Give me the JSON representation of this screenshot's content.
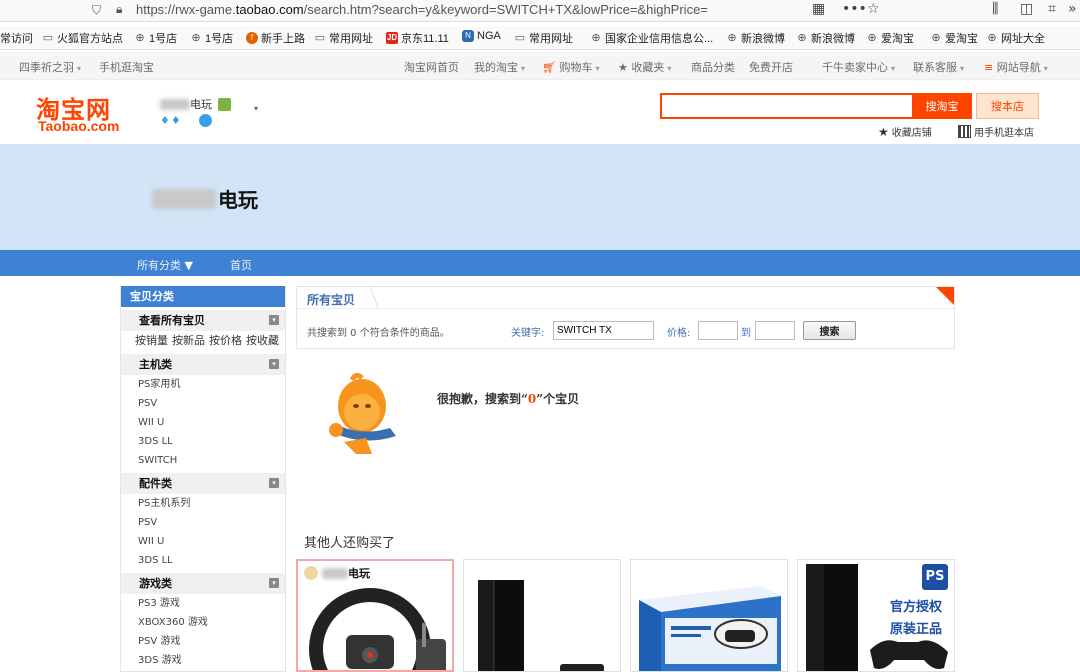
{
  "browser": {
    "url_prefix": "https://rwx-game.",
    "url_host": "taobao.com",
    "url_suffix": "/search.htm?search=y&keyword=SWITCH+TX&lowPrice=&highPrice="
  },
  "bookmarks": [
    {
      "label": "常访问",
      "icon": "none"
    },
    {
      "label": "火狐官方站点",
      "icon": "folder"
    },
    {
      "label": "1号店",
      "icon": "globe"
    },
    {
      "label": "1号店",
      "icon": "globe"
    },
    {
      "label": "新手上路",
      "icon": "firefox"
    },
    {
      "label": "常用网址",
      "icon": "folder"
    },
    {
      "label": "京东11.11",
      "icon": "jd"
    },
    {
      "label": "NGA",
      "icon": "nga"
    },
    {
      "label": "常用网址",
      "icon": "folder"
    },
    {
      "label": "国家企业信用信息公...",
      "icon": "globe"
    },
    {
      "label": "新浪微博",
      "icon": "globe"
    },
    {
      "label": "新浪微博",
      "icon": "globe"
    },
    {
      "label": "爱淘宝",
      "icon": "globe"
    },
    {
      "label": "爱淘宝",
      "icon": "globe"
    },
    {
      "label": "网址大全",
      "icon": "globe"
    }
  ],
  "topnav": {
    "user": "四季祈之羽",
    "mobile": "手机逛淘宝",
    "home": "淘宝网首页",
    "my_taobao": "我的淘宝",
    "cart": "购物车",
    "favorites": "收藏夹",
    "categories": "商品分类",
    "free_shop": "免费开店",
    "seller_center": "千牛卖家中心",
    "service": "联系客服",
    "site_nav": "网站导航"
  },
  "header": {
    "logo_cn": "淘宝网",
    "logo_en": "Taobao.com",
    "shop_name_suffix": "电玩",
    "search_placeholder": "",
    "btn_search_taobao": "搜淘宝",
    "btn_search_shop": "搜本店",
    "fav_shop": "收藏店铺",
    "mobile_shop": "用手机逛本店"
  },
  "banner": {
    "shop_name_suffix": "电玩"
  },
  "shopnav": {
    "all_categories": "所有分类",
    "home": "首页"
  },
  "sidebar": {
    "title": "宝贝分类",
    "view_all": "查看所有宝贝",
    "sort_links": [
      "按销量",
      "按新品",
      "按价格",
      "按收藏"
    ],
    "groups": [
      {
        "name": "主机类",
        "items": [
          "PS家用机",
          "PSV",
          "WII U",
          "3DS LL",
          "SWITCH"
        ]
      },
      {
        "name": "配件类",
        "items": [
          "PS主机系列",
          "PSV",
          "WII U",
          "3DS LL"
        ]
      },
      {
        "name": "游戏类",
        "items": [
          "PS3 游戏",
          "XBOX360 游戏",
          "PSV 游戏",
          "3DS 游戏"
        ]
      }
    ]
  },
  "main": {
    "title": "所有宝贝",
    "result_count": "共搜索到 0 个符合条件的商品。",
    "keyword_label": "关键字:",
    "keyword_value": "SWITCH TX",
    "price_label": "价格:",
    "to_label": "到",
    "search_btn": "搜索",
    "sorry_prefix": "很抱歉，搜索到“",
    "sorry_count": "0",
    "sorry_suffix": "”个宝贝",
    "others_title": "其他人还购买了"
  },
  "cards": [
    {
      "label": "电玩",
      "badge": "",
      "text1": "",
      "text2": ""
    },
    {
      "label": "",
      "badge": "",
      "text1": "",
      "text2": ""
    },
    {
      "label": "",
      "badge": "",
      "text1": "",
      "text2": ""
    },
    {
      "label": "",
      "badge": "PS",
      "text1": "官方授权",
      "text2": "原装正品"
    }
  ],
  "colors": {
    "taobao_orange": "#ff4400",
    "shop_blue": "#3f82d4",
    "banner_bg": "#d3e4f7"
  }
}
